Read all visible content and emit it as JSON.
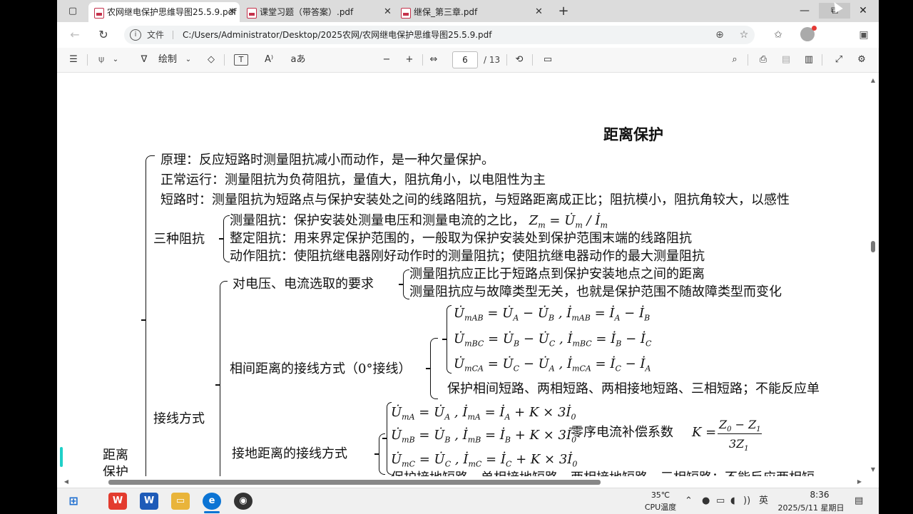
{
  "tabs": [
    {
      "label": "农网继电保护思维导图25.5.9.pdf",
      "active": true
    },
    {
      "label": "课堂习题（带答案）.pdf",
      "active": false
    },
    {
      "label": "继保_第三章.pdf",
      "active": false
    }
  ],
  "address": {
    "file_label": "文件",
    "url": "C:/Users/Administrator/Desktop/2025农网/农网继电保护思维导图25.5.9.pdf"
  },
  "pdf_toolbar": {
    "draw_label": "绘制",
    "text_tool": "T",
    "read_aloud": "A⁾",
    "translate": "aあ",
    "zoom_out": "−",
    "zoom_in": "+",
    "page_current": "6",
    "page_total": "/ 13"
  },
  "document": {
    "title": "距离保护",
    "root_label_1": "距离",
    "root_label_2": "保护",
    "principle": "原理：反应短路时测量阻抗减小而动作，是一种欠量保护。",
    "normal": "正常运行：测量阻抗为负荷阻抗，量值大，阻抗角小，以电阻性为主",
    "fault": "短路时：测量阻抗为短路点与保护安装处之间的线路阻抗，与短路距离成正比；阻抗模小，阻抗角较大，以感性",
    "three_impedances": {
      "label": "三种阻抗",
      "measured": "测量阻抗：保护安装处测量电压和测量电流的之比，",
      "measured_formula": "Z",
      "setting": "整定阻抗：用来界定保护范围的，一般取为保护安装处到保护范围末端的线路阻抗",
      "operate": "动作阻抗：使阻抗继电器刚好动作时的测量阻抗；使阻抗继电器动作的最大测量阻抗"
    },
    "wiring": {
      "label": "接线方式",
      "requirement_label": "对电压、电流选取的要求",
      "req_1": "测量阻抗应正比于短路点到保护安装地点之间的距离",
      "req_2": "测量阻抗应与故障类型无关，也就是保护范围不随故障类型而变化",
      "phase_label": "相间距离的接线方式（0°接线）",
      "phase_note": "保护相间短路、两相短路、两相接地短路、三相短路；不能反应单",
      "ground_label": "接地距离的接线方式",
      "comp_label": "零序电流补偿系数",
      "ground_note": "保护接地短路、单相接地短路、两相接地短路、三相短路；不能反应两相短"
    }
  },
  "taskbar": {
    "temperature": "35℃",
    "weather_label": "CPU温度",
    "ime": "英",
    "time": "8:36",
    "date": "2025/5/11 星期日"
  },
  "colors": {
    "tab_bar": "#dcdcdc",
    "pdf_red": "#c4314b",
    "accent_teal": "#1fd0c8",
    "edge_blue": "#0b74d4"
  }
}
